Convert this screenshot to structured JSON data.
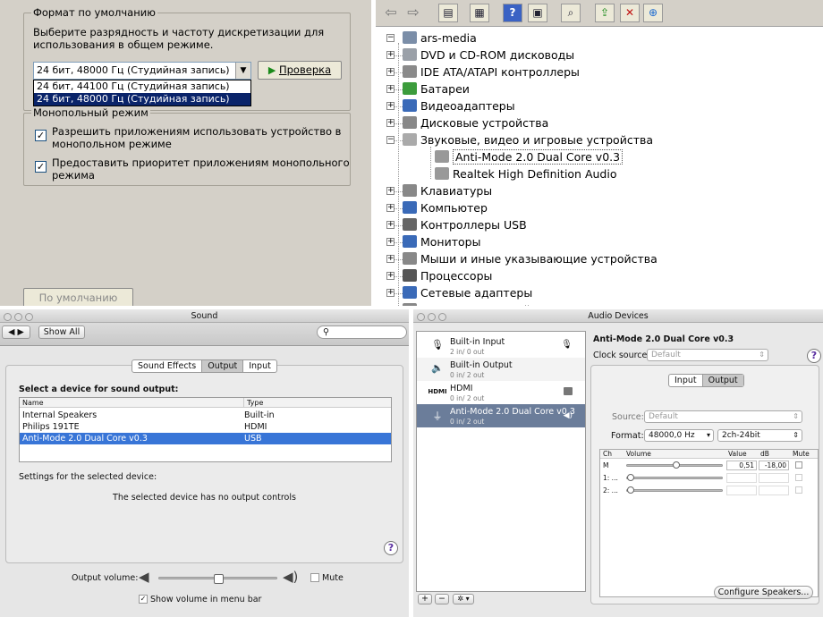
{
  "win_xp_sound": {
    "group_default": "Формат по умолчанию",
    "desc_line1": "Выберите разрядность и частоту дискретизации для",
    "desc_line2": "использования в общем режиме.",
    "combo_value": "24 бит, 48000 Гц (Студийная запись)",
    "dropdown_options": [
      "24 бит, 44100 Гц (Студийная запись)",
      "24 бит, 48000 Гц (Студийная запись)"
    ],
    "test_button": "Проверка",
    "group_exclusive": "Монопольный режим",
    "exclusive_opt1_l1": "Разрешить приложениям использовать устройство в",
    "exclusive_opt1_l2": "монопольном режиме",
    "exclusive_opt2_l1": "Предоставить приоритет приложениям монопольного",
    "exclusive_opt2_l2": "режима",
    "defaults_button": "По умолчанию"
  },
  "device_manager": {
    "root": "ars-media",
    "items": [
      {
        "label": "DVD и CD-ROM дисководы",
        "color": "#9aa0a8"
      },
      {
        "label": "IDE ATA/ATAPI контроллеры",
        "color": "#8a8a8a"
      },
      {
        "label": "Батареи",
        "color": "#3c9c3c"
      },
      {
        "label": "Видеоадаптеры",
        "color": "#3a6ab8"
      },
      {
        "label": "Дисковые устройства",
        "color": "#888888"
      },
      {
        "label": "Звуковые, видео и игровые устройства",
        "color": "#aaaaaa"
      },
      {
        "label": "Anti-Mode 2.0 Dual Core v0.3",
        "color": "#999999"
      },
      {
        "label": "Realtek High Definition Audio",
        "color": "#999999"
      },
      {
        "label": "Клавиатуры",
        "color": "#888888"
      },
      {
        "label": "Компьютер",
        "color": "#3a6ab8"
      },
      {
        "label": "Контроллеры USB",
        "color": "#666666"
      },
      {
        "label": "Мониторы",
        "color": "#3a6ab8"
      },
      {
        "label": "Мыши и иные указывающие устройства",
        "color": "#888888"
      },
      {
        "label": "Процессоры",
        "color": "#555555"
      },
      {
        "label": "Сетевые адаптеры",
        "color": "#3a6ab8"
      },
      {
        "label": "Системные устройства",
        "color": "#888888"
      }
    ]
  },
  "mac_sound": {
    "title": "Sound",
    "show_all": "Show All",
    "search_placeholder": "",
    "tabs": [
      "Sound Effects",
      "Output",
      "Input"
    ],
    "select_label": "Select a device for sound output:",
    "col_name": "Name",
    "col_type": "Type",
    "rows": [
      {
        "name": "Internal Speakers",
        "type": "Built-in"
      },
      {
        "name": "Philips 191TE",
        "type": "HDMI"
      },
      {
        "name": "Anti-Mode 2.0 Dual Core v0.3",
        "type": "USB"
      }
    ],
    "settings_label": "Settings for the selected device:",
    "no_controls": "The selected device has no output controls",
    "output_volume": "Output volume:",
    "volume_level": 0.5,
    "mute": "Mute",
    "show_volume": "Show volume in menu bar"
  },
  "audio_devices": {
    "title": "Audio Devices",
    "devices": [
      {
        "name": "Built-in Input",
        "sub": "2 in/ 0 out"
      },
      {
        "name": "Built-in Output",
        "sub": "0 in/ 2 out"
      },
      {
        "name": "HDMI",
        "sub": "0 in/ 2 out"
      },
      {
        "name": "Anti-Mode 2.0 Dual Core v0.3",
        "sub": "0 in/ 2 out"
      }
    ],
    "hdmi_label": "HDMI",
    "selected_name": "Anti-Mode 2.0 Dual Core v0.3",
    "clock_label": "Clock source:",
    "clock_value": "Default",
    "tab_input": "Input",
    "tab_output": "Output",
    "source_label": "Source:",
    "source_value": "Default",
    "format_label": "Format:",
    "format_rate": "48000,0 Hz",
    "format_bits": "2ch-24bit",
    "col_ch": "Ch",
    "col_volume": "Volume",
    "col_value": "Value",
    "col_db": "dB",
    "col_mute": "Mute",
    "channels": [
      {
        "ch": "M",
        "value": "0,51",
        "db": "-18,00"
      },
      {
        "ch": "1: ...",
        "value": "",
        "db": ""
      },
      {
        "ch": "2: ...",
        "value": "",
        "db": ""
      }
    ],
    "master_level": 0.51,
    "plus": "+",
    "minus": "−",
    "gear": "✲ ▾",
    "configure": "Configure Speakers..."
  }
}
